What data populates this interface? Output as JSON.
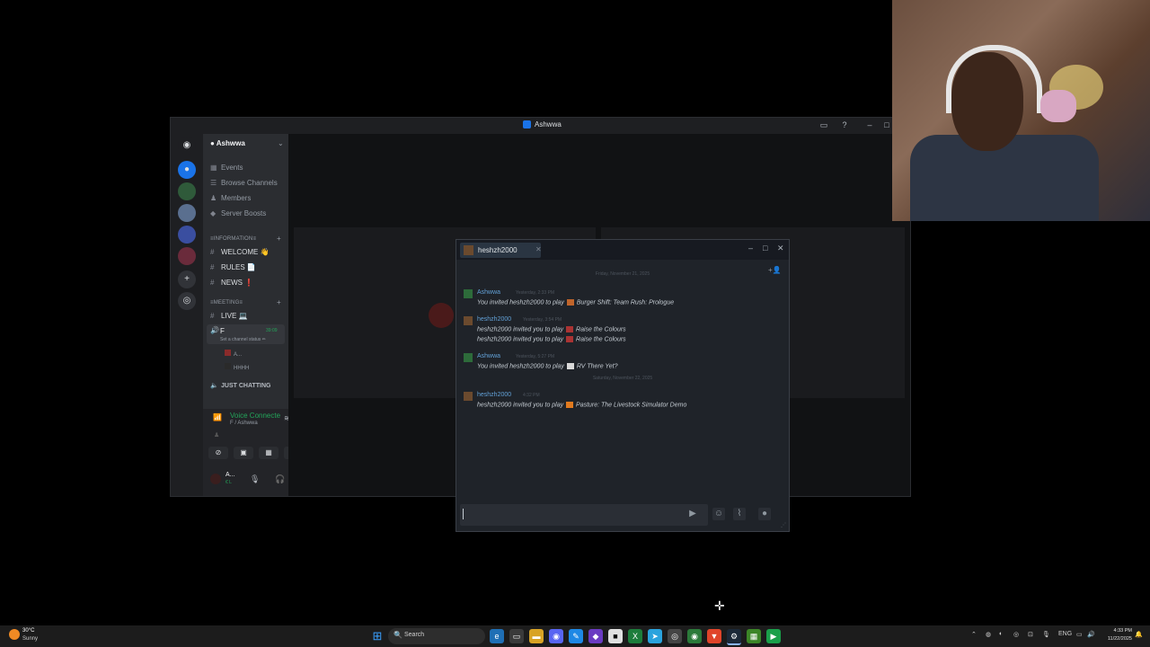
{
  "discord": {
    "window_title": "Ashwwa",
    "server_name": "Ashwwa",
    "menu_items": [
      "Events",
      "Browse Channels",
      "Members",
      "Server Boosts"
    ],
    "category_information": "≡INFORMATION≡",
    "channels_info": [
      "WELCOME 👋",
      "RULES 📄",
      "NEWS ❗"
    ],
    "category_meeting": "≡MEETING≡",
    "channel_live": "LIVE 💻",
    "voice_channel": {
      "name": "F",
      "timer": "39:09",
      "status_hint": "Set a channel status ✏"
    },
    "voice_users": [
      "A...",
      "HHHH"
    ],
    "channel_just_chatting": "JUST CHATTING",
    "voice_connected": {
      "title": "Voice Connecte",
      "subtitle": "F / Ashwwa"
    },
    "user_panel": {
      "name": "A...",
      "sub": "€ L"
    }
  },
  "steam_chat": {
    "tab_name": "heshzh2000",
    "messages": [
      {
        "date": "Friday, November 21, 2025"
      },
      {
        "author": "Ashwwa",
        "time": "Yesterday, 2:33 PM",
        "lines": [
          {
            "pre": "You invited heshzh2000 to play",
            "game": "Burger Shift: Team Rush: Prologue"
          }
        ]
      },
      {
        "author": "heshzh2000",
        "time": "Yesterday, 3:54 PM",
        "lines": [
          {
            "pre": "heshzh2000 invited you to play",
            "game": "Raise the Colours"
          },
          {
            "pre": "heshzh2000 invited you to play",
            "game": "Raise the Colours"
          }
        ]
      },
      {
        "author": "Ashwwa",
        "time": "Yesterday, 5:27 PM",
        "lines": [
          {
            "pre": "You invited heshzh2000 to play",
            "game": "RV There Yet?"
          }
        ]
      },
      {
        "date": "Saturday, November 22, 2025"
      },
      {
        "author": "heshzh2000",
        "time": "4:32 PM",
        "lines": [
          {
            "pre": "heshzh2000 invited you to play",
            "game": "Pasture: The Livestock Simulator Demo"
          }
        ]
      }
    ]
  },
  "taskbar": {
    "weather_temp": "30°C",
    "weather_desc": "Sunny",
    "search_label": "Search",
    "lang": "ENG",
    "time": "4:33 PM",
    "date": "11/22/2025"
  }
}
